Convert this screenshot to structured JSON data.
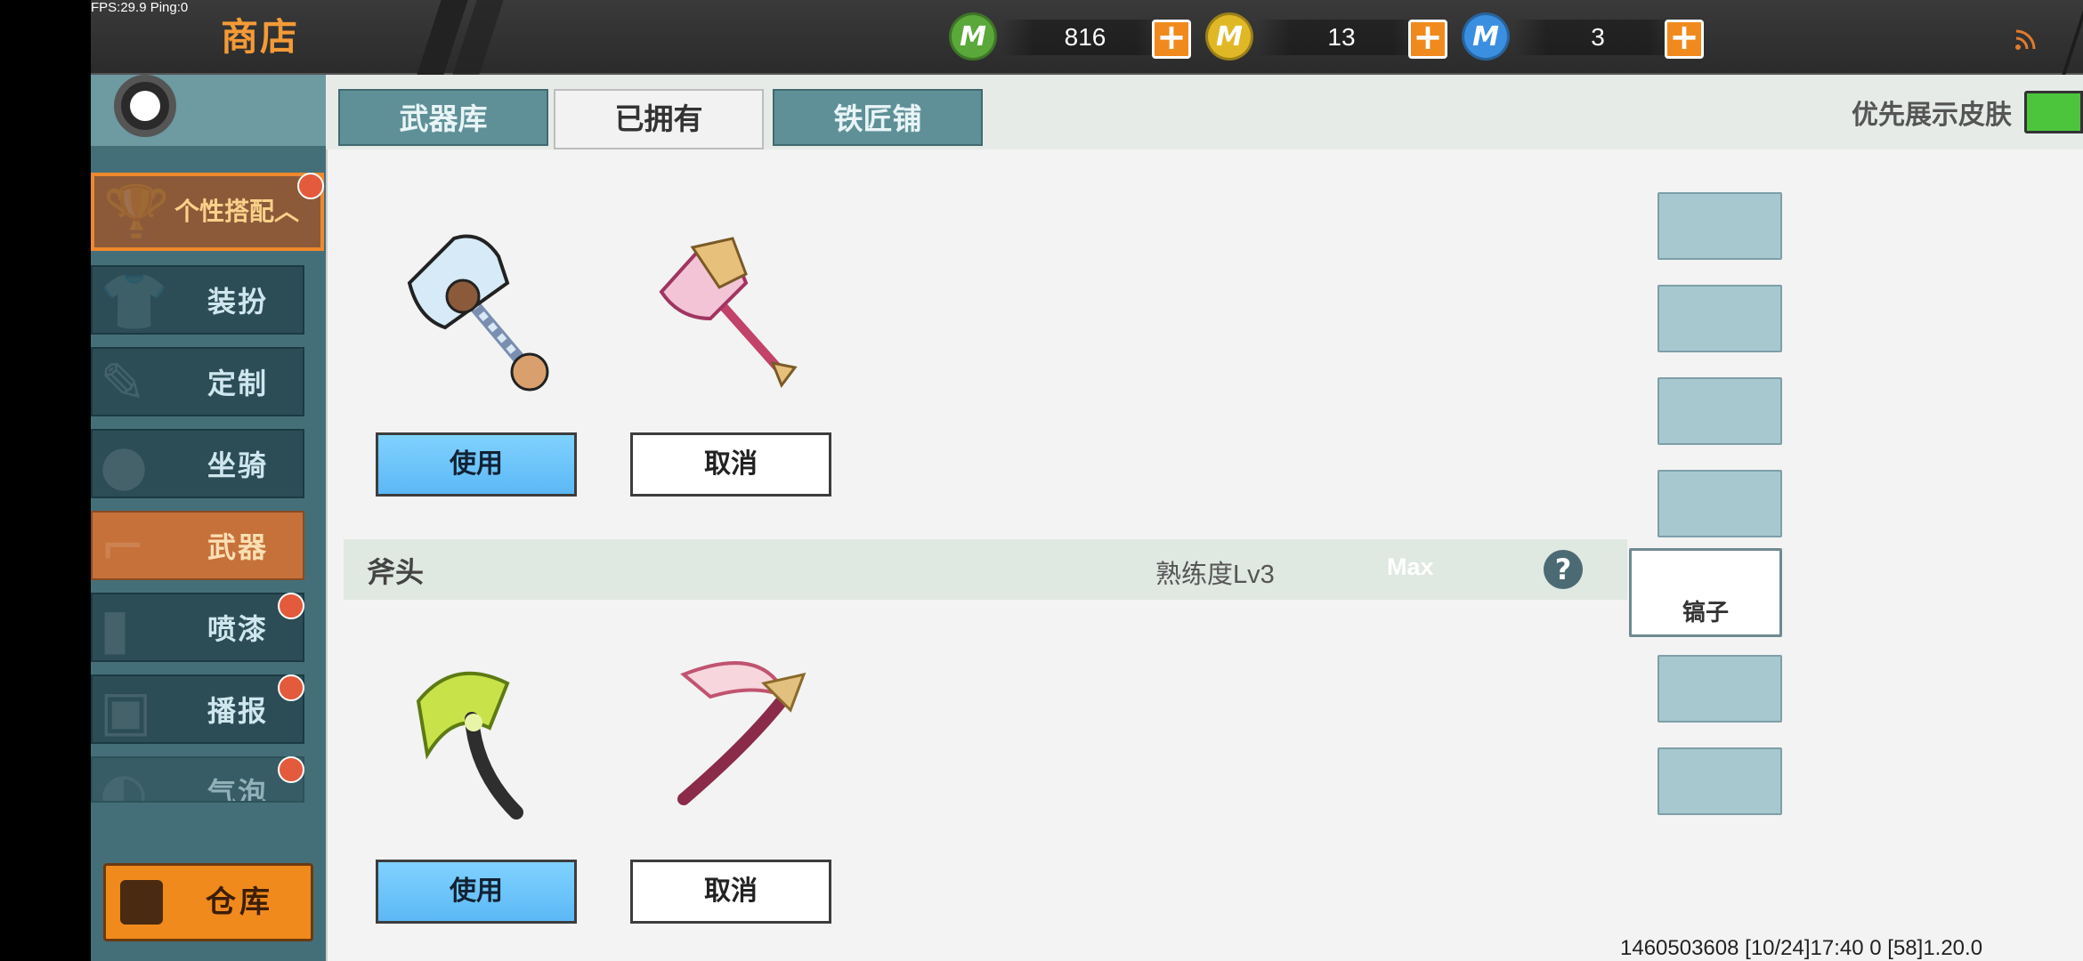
{
  "debug": "FPS:29.9  Ping:0",
  "header": {
    "title": "商店"
  },
  "currencies": [
    {
      "icon": "green-coin-icon",
      "symbol": "M",
      "color": "#5aa83a",
      "value": "816"
    },
    {
      "icon": "gold-coin-icon",
      "symbol": "M",
      "color": "#e0b825",
      "value": "13"
    },
    {
      "icon": "blue-coin-icon",
      "symbol": "M",
      "color": "#3a8fe0",
      "value": "3"
    }
  ],
  "plus_label": "+",
  "close_label": "✕",
  "sidebar": {
    "parent": "个性搭配︿",
    "items": [
      {
        "label": "装扮",
        "badge": false
      },
      {
        "label": "定制",
        "badge": false
      },
      {
        "label": "坐骑",
        "badge": false
      },
      {
        "label": "武器",
        "badge": false,
        "active": true
      },
      {
        "label": "喷漆",
        "badge": true
      },
      {
        "label": "播报",
        "badge": true
      },
      {
        "label": "气泡",
        "badge": true
      }
    ],
    "warehouse": "仓库"
  },
  "tabs": [
    {
      "label": "武器库",
      "active": false
    },
    {
      "label": "已拥有",
      "active": true
    },
    {
      "label": "铁匠铺",
      "active": false
    }
  ],
  "priority": {
    "label": "优先展示皮肤",
    "toggle": "开"
  },
  "buttons": {
    "use": "使用",
    "cancel": "取消"
  },
  "section": {
    "name": "斧头",
    "proficiency": "熟练度Lv3",
    "max": "Max",
    "help": "?"
  },
  "right_slots": {
    "active_label": "镐子"
  },
  "footer": "1460503608   [10/24]17:40 0   [58]1.20.0"
}
